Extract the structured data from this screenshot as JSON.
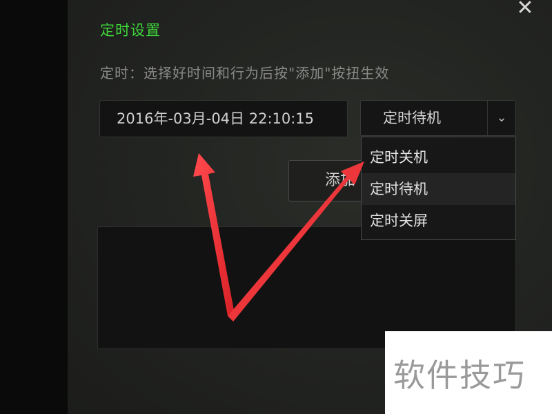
{
  "dialog": {
    "title": "定时设置",
    "hint": "定时：选择好时间和行为后按\"添加\"按扭生效",
    "close_glyph": "✕"
  },
  "form": {
    "datetime_value": "2016年-03月-04日 22:10:15",
    "action_selected": "定时待机",
    "add_button_partial": "添加"
  },
  "dropdown": {
    "options": [
      {
        "label": "定时关机",
        "selected": false
      },
      {
        "label": "定时待机",
        "selected": true
      },
      {
        "label": "定时关屏",
        "selected": false
      }
    ]
  },
  "watermark": {
    "text": "软件技巧"
  },
  "colors": {
    "title_green": "#3fd33a",
    "arrow_red": "#f0353a"
  }
}
